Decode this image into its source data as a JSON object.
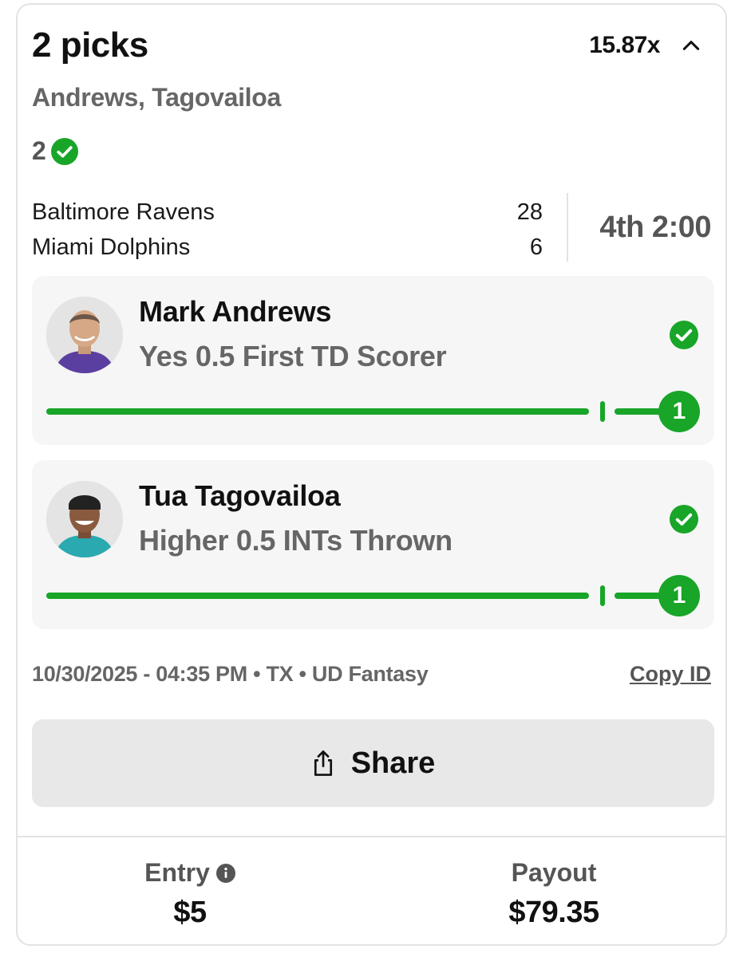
{
  "header": {
    "title": "2 picks",
    "multiplier": "15.87x",
    "collapse_icon": "chevron-up-icon",
    "players_summary": "Andrews, Tagovailoa",
    "correct_count": "2",
    "correct_icon": "check-circle-icon"
  },
  "game": {
    "teams": [
      {
        "name": "Baltimore Ravens",
        "score": "28"
      },
      {
        "name": "Miami Dolphins",
        "score": "6"
      }
    ],
    "clock": "4th 2:00"
  },
  "picks": [
    {
      "player": "Mark Andrews",
      "line": "Yes 0.5 First TD Scorer",
      "result_icon": "check-circle-icon",
      "progress_value": "1",
      "progress_fraction": 1.0,
      "jersey_color": "#5b3fa0"
    },
    {
      "player": "Tua Tagovailoa",
      "line": "Higher 0.5 INTs Thrown",
      "result_icon": "check-circle-icon",
      "progress_value": "1",
      "progress_fraction": 1.0,
      "jersey_color": "#2aa9b0"
    }
  ],
  "meta": {
    "details": "10/30/2025 - 04:35 PM • TX • UD Fantasy",
    "copy_id_label": "Copy ID"
  },
  "share": {
    "label": "Share",
    "icon": "share-icon"
  },
  "footer": {
    "entry_label": "Entry",
    "entry_info_icon": "info-icon",
    "entry_value": "$5",
    "payout_label": "Payout",
    "payout_value": "$79.35"
  },
  "colors": {
    "accent_green": "#18a528",
    "muted_text": "#666666",
    "card_bg": "#f6f6f6"
  }
}
